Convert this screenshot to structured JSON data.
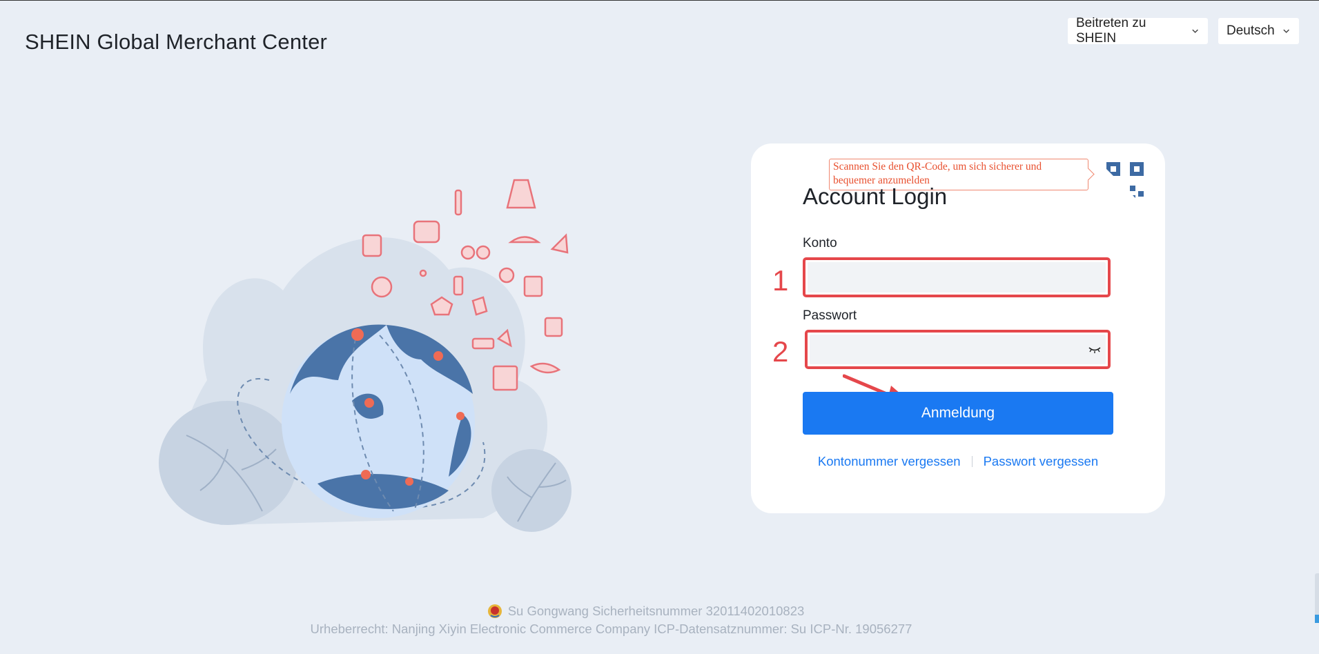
{
  "header": {
    "brand": "SHEIN Global Merchant Center",
    "join_label": "Beitreten zu SHEIN",
    "language_label": "Deutsch"
  },
  "login": {
    "qr_tooltip": "Scannen Sie den QR-Code, um sich sicherer und bequemer anzumelden",
    "title": "Account Login",
    "account_label": "Konto",
    "account_value": "",
    "password_label": "Passwort",
    "password_value": "",
    "submit_label": "Anmeldung",
    "forgot_account": "Kontonummer vergessen",
    "forgot_password": "Passwort vergessen"
  },
  "annotations": {
    "step1": "1",
    "step2": "2",
    "color": "#e5474b"
  },
  "footer": {
    "security_number": "Su Gongwang Sicherheitsnummer 32011402010823",
    "copyright": "Urheberrecht: Nanjing Xiyin Electronic Commerce Company  ICP-Datensatznummer: Su ICP-Nr. 19056277"
  },
  "icons": [
    "chevron-down-icon",
    "qr-code-icon",
    "eye-closed-icon",
    "police-emblem-icon"
  ],
  "colors": {
    "background": "#e9eef5",
    "primary": "#1a79f2",
    "annotation": "#e5474b",
    "globe": "#4a74a8"
  }
}
